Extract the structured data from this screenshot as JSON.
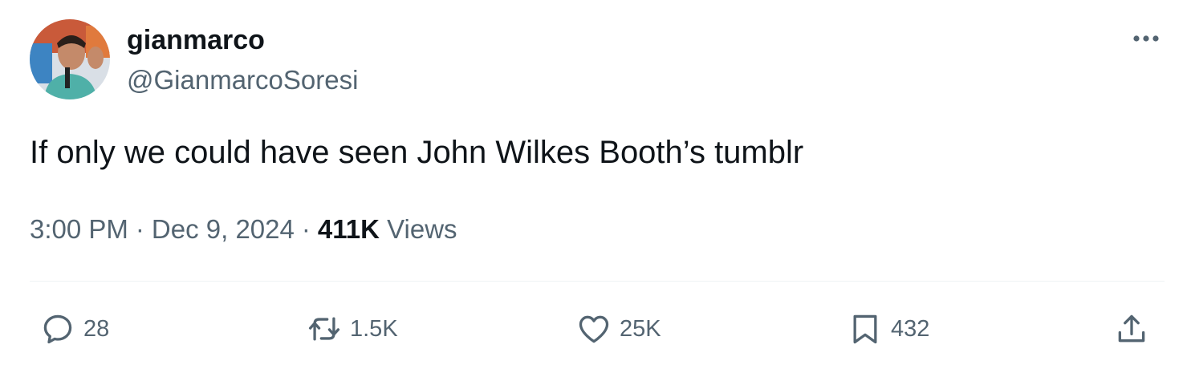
{
  "user": {
    "display_name": "gianmarco",
    "handle": "@GianmarcoSoresi",
    "avatar_icon": "avatar-photo"
  },
  "tweet": {
    "text": "If only we could have seen John Wilkes Booth’s tumblr",
    "time": "3:00 PM",
    "separator": "·",
    "date": "Dec 9, 2024",
    "views_count": "411K",
    "views_label": "Views"
  },
  "actions": {
    "replies": "28",
    "reposts": "1.5K",
    "likes": "25K",
    "bookmarks": "432"
  },
  "icons": {
    "more": "more-horizontal-icon",
    "reply": "reply-icon",
    "repost": "repost-icon",
    "like": "heart-icon",
    "bookmark": "bookmark-icon",
    "share": "share-icon"
  },
  "colors": {
    "text_primary": "#0f1419",
    "text_secondary": "#536471",
    "divider": "#eff3f4"
  }
}
